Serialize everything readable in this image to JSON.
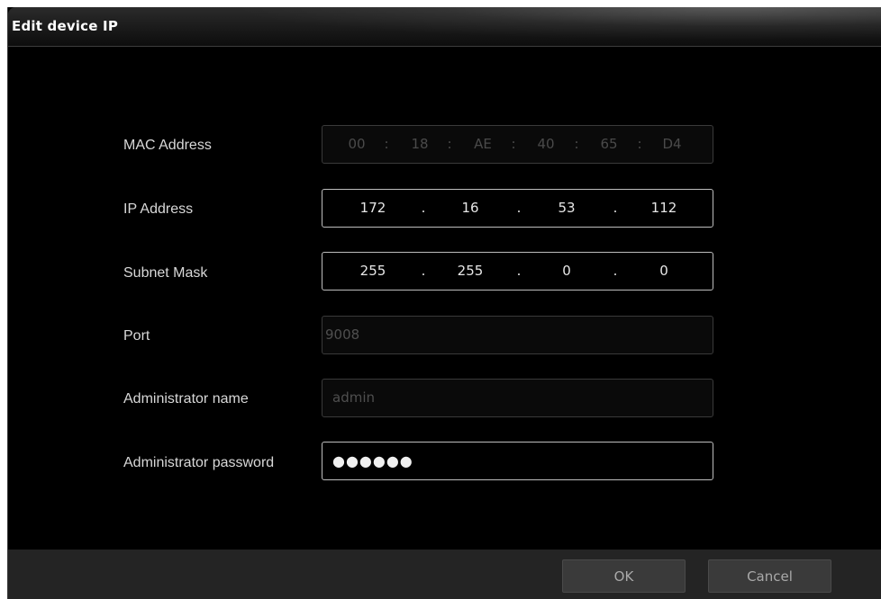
{
  "dialog": {
    "title": "Edit device IP"
  },
  "form": {
    "mac_label": "MAC Address",
    "mac_segments": [
      "00",
      "18",
      "AE",
      "40",
      "65",
      "D4"
    ],
    "mac_separator": ":",
    "ip_label": "IP Address",
    "ip_segments": [
      "172",
      "16",
      "53",
      "112"
    ],
    "subnet_label": "Subnet Mask",
    "subnet_segments": [
      "255",
      "255",
      "0",
      "0"
    ],
    "octet_separator": ".",
    "port_label": "Port",
    "port_value": "9008",
    "admin_name_label": "Administrator name",
    "admin_name_value": "admin",
    "admin_password_label": "Administrator password",
    "admin_password_value": "●●●●●●"
  },
  "footer": {
    "ok_label": "OK",
    "cancel_label": "Cancel"
  },
  "colors": {
    "background": "#000000",
    "footer": "#242424",
    "button": "#3a3a3a",
    "label_text": "#d8d8d8",
    "disabled_text": "#4a4a4a"
  }
}
